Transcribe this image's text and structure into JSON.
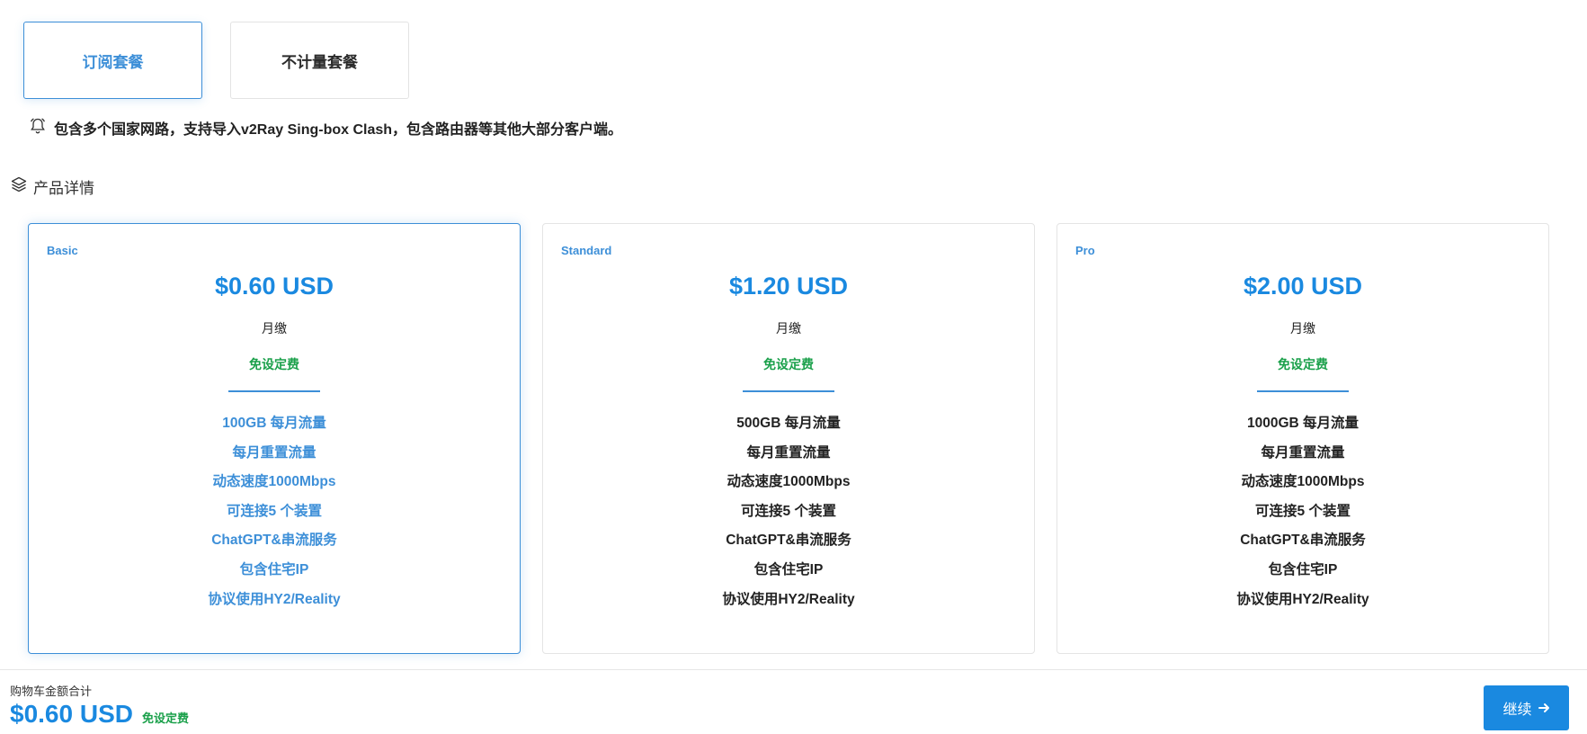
{
  "tabs": [
    {
      "label": "订阅套餐",
      "active": true
    },
    {
      "label": "不计量套餐",
      "active": false
    }
  ],
  "notice": {
    "icon": "bell-icon",
    "text": "包含多个国家网路，支持导入v2Ray Sing-box Clash，包含路由器等其他大部分客户端。"
  },
  "section": {
    "icon": "layers-icon",
    "title": "产品详情"
  },
  "plans": [
    {
      "name": "Basic",
      "price": "$0.60 USD",
      "period": "月缴",
      "setup": "免设定费",
      "selected": true,
      "features": [
        "100GB 每月流量",
        "每月重置流量",
        "动态速度1000Mbps",
        "可连接5 个装置",
        "ChatGPT&串流服务",
        "包含住宅IP",
        "协议使用HY2/Reality"
      ]
    },
    {
      "name": "Standard",
      "price": "$1.20 USD",
      "period": "月缴",
      "setup": "免设定费",
      "selected": false,
      "features": [
        "500GB 每月流量",
        "每月重置流量",
        "动态速度1000Mbps",
        "可连接5 个装置",
        "ChatGPT&串流服务",
        "包含住宅IP",
        "协议使用HY2/Reality"
      ]
    },
    {
      "name": "Pro",
      "price": "$2.00 USD",
      "period": "月缴",
      "setup": "免设定费",
      "selected": false,
      "features": [
        "1000GB 每月流量",
        "每月重置流量",
        "动态速度1000Mbps",
        "可连接5 个装置",
        "ChatGPT&串流服务",
        "包含住宅IP",
        "协议使用HY2/Reality"
      ]
    }
  ],
  "cart": {
    "label": "购物车金额合计",
    "total": "$0.60 USD",
    "setup": "免设定费"
  },
  "continue_button": {
    "label": "继续",
    "icon": "arrow-right-icon"
  },
  "colors": {
    "accent": "#1a89e0",
    "selected_border": "#3d8fd8",
    "setup_green": "#1aa04a"
  }
}
